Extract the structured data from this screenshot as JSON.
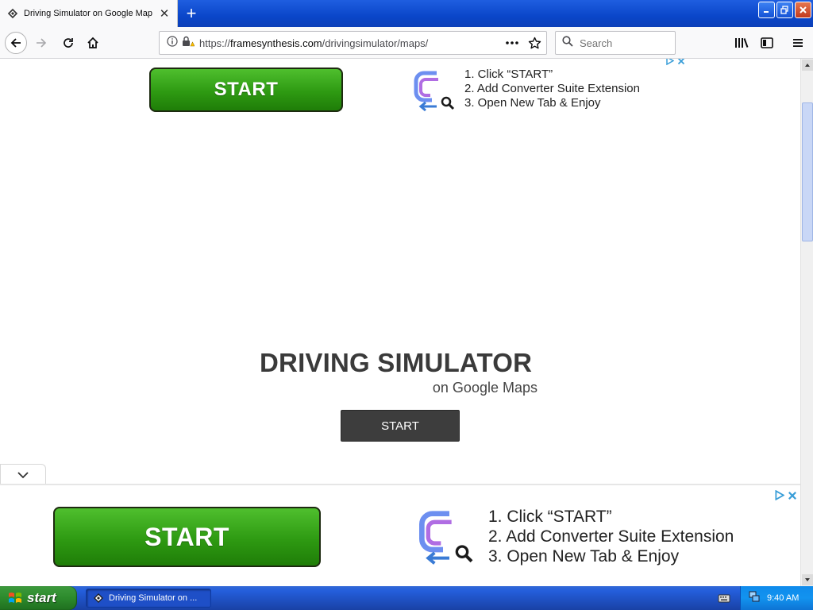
{
  "browser": {
    "tab_title": "Driving Simulator on Google Maps",
    "url_prefix": "https://",
    "url_host": "framesynthesis.com",
    "url_path": "/drivingsimulator/maps/",
    "search_placeholder": "Search"
  },
  "top_ad": {
    "start_label": "START",
    "steps": [
      "1. Click “START”",
      "2. Add Converter Suite Extension",
      "3. Open New Tab & Enjoy"
    ],
    "adchoice_icon": "adchoices-icon",
    "close_icon": "close-icon"
  },
  "hero": {
    "title": "DRIVING SIMULATOR",
    "subtitle": "on Google Maps",
    "start_label": "START"
  },
  "bottom_ad": {
    "start_label": "START",
    "steps": [
      "1. Click “START”",
      "2. Add Converter Suite Extension",
      "3. Open New Tab & Enjoy"
    ]
  },
  "taskbar": {
    "start_label": "start",
    "task_label": "Driving Simulator on ...",
    "clock": "9:40 AM"
  },
  "colors": {
    "xp_blue": "#245edb",
    "ad_green": "#2e9a12",
    "hero_text": "#3a3a3a",
    "dark_button": "#3d3d3d",
    "adchoice_blue": "#3a9ed8"
  }
}
